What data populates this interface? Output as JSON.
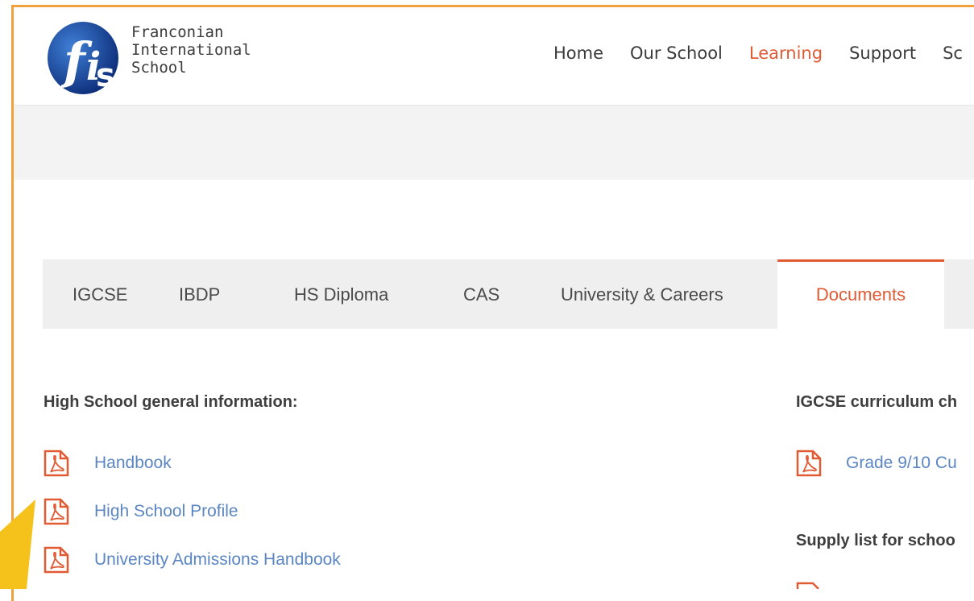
{
  "logo": {
    "line1": "Franconian",
    "line2": "International",
    "line3": "School",
    "monogram": "fis"
  },
  "nav": {
    "items": [
      "Home",
      "Our School",
      "Learning",
      "Support",
      "Sc"
    ],
    "active": "Learning"
  },
  "tabs": {
    "items": [
      "IGCSE",
      "IBDP",
      "HS Diploma",
      "CAS",
      "University & Careers",
      "Documents"
    ],
    "active": "Documents"
  },
  "left_column": {
    "title": "High School general information:",
    "links": [
      "Handbook",
      "High School Profile",
      "University Admissions Handbook"
    ]
  },
  "right_column": {
    "title1": "IGCSE curriculum ch",
    "link1": "Grade 9/10 Cu",
    "title2": "Supply list for schoo"
  },
  "colors": {
    "accent": "#e05a34",
    "link": "#5b86c2",
    "frame": "#f0a03c",
    "arrow": "#f5c21b"
  },
  "icons": {
    "document": "pdf-icon",
    "pointer": "arrow-icon"
  }
}
